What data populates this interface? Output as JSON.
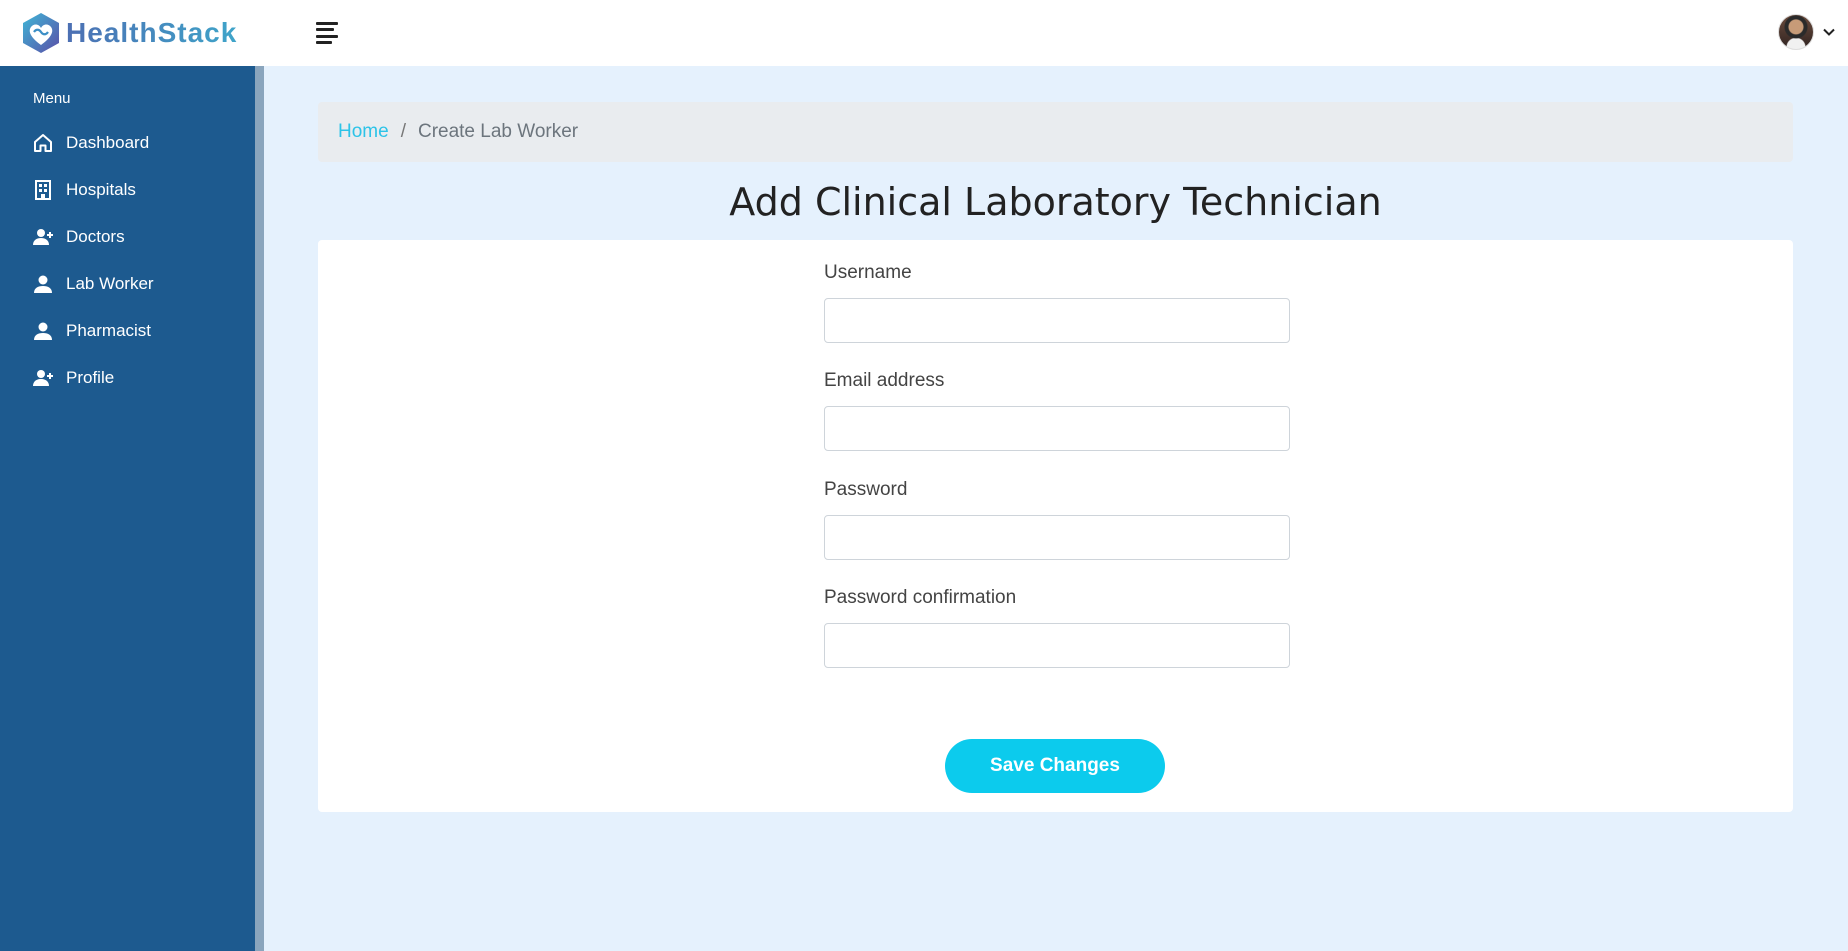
{
  "app": {
    "brand_name": "HealthStack",
    "brand_color": "#4c6fb3",
    "logo_icon": "heart-infinity-logo",
    "hamburger_icon": "hamburger-menu-icon",
    "avatar_icon": "user-avatar",
    "dropdown_icon": "chevron-down-icon"
  },
  "sidebar": {
    "background": "#1d5a8f",
    "menu_title": "Menu",
    "items": [
      {
        "label": "Dashboard",
        "icon": "home-icon"
      },
      {
        "label": "Hospitals",
        "icon": "building-icon"
      },
      {
        "label": "Doctors",
        "icon": "user-plus-icon"
      },
      {
        "label": "Lab Worker",
        "icon": "user-icon"
      },
      {
        "label": "Pharmacist",
        "icon": "user-icon"
      },
      {
        "label": "Profile",
        "icon": "user-plus-icon"
      }
    ]
  },
  "breadcrumb": {
    "home": "Home",
    "separator": "/",
    "current": "Create Lab Worker",
    "link_color": "#2cc3e8"
  },
  "page": {
    "title": "Add Clinical Laboratory Technician"
  },
  "form": {
    "username_label": "Username",
    "username_value": "",
    "email_label": "Email address",
    "email_value": "",
    "password_label": "Password",
    "password_value": "",
    "password_confirmation_label": "Password confirmation",
    "password_confirmation_value": "",
    "save_label": "Save Changes",
    "save_color": "#0ccbed"
  }
}
